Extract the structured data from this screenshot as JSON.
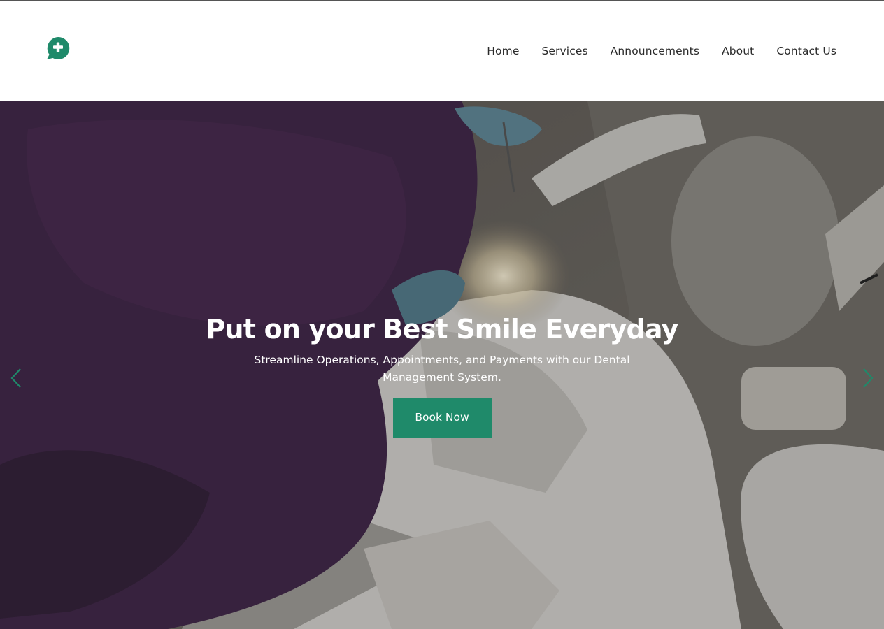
{
  "header": {
    "logo_icon": "speech-bubble-plus-icon",
    "brand_color": "#1f8a6a"
  },
  "nav": {
    "items": [
      {
        "label": "Home"
      },
      {
        "label": "Services"
      },
      {
        "label": "Announcements"
      },
      {
        "label": "About"
      },
      {
        "label": "Contact Us"
      }
    ]
  },
  "hero": {
    "title": "Put on your Best Smile Everyday",
    "subtitle": "Streamline Operations, Appointments, and Payments with our Dental Management System.",
    "cta_label": "Book Now",
    "prev_icon": "chevron-left-icon",
    "next_icon": "chevron-right-icon",
    "accent_color": "#1f8a6a"
  }
}
